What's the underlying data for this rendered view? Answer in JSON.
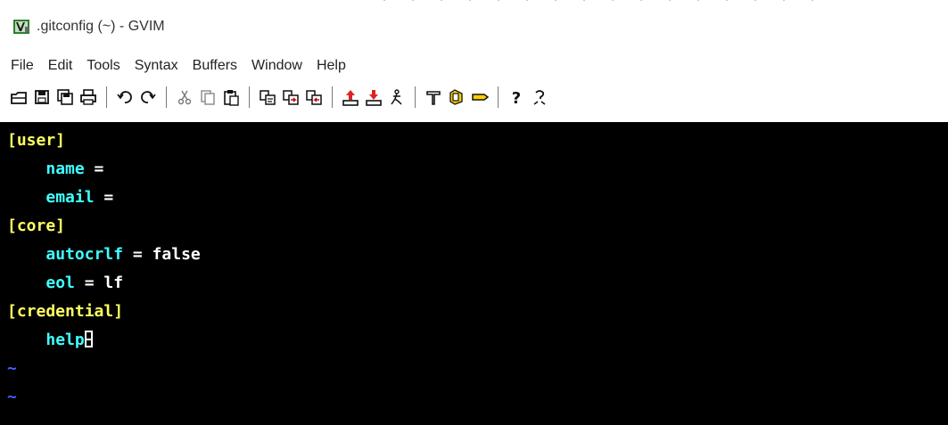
{
  "window": {
    "title": ".gitconfig (~) - GVIM",
    "app_icon": "gvim-icon"
  },
  "menubar": {
    "items": [
      "File",
      "Edit",
      "Tools",
      "Syntax",
      "Buffers",
      "Window",
      "Help"
    ]
  },
  "toolbar": {
    "groups": [
      [
        "open-icon",
        "save-icon",
        "save-all-icon",
        "print-icon"
      ],
      [
        "undo-icon",
        "redo-icon"
      ],
      [
        "cut-icon",
        "copy-icon",
        "paste-icon"
      ],
      [
        "replace-icon",
        "find-next-icon",
        "find-prev-icon"
      ],
      [
        "load-session-icon",
        "save-session-icon",
        "run-script-icon"
      ],
      [
        "make-icon",
        "build-tags-icon",
        "jump-to-tag-icon"
      ],
      [
        "help-icon",
        "find-help-icon"
      ]
    ]
  },
  "editor": {
    "lines": [
      {
        "type": "section",
        "text": "[user]"
      },
      {
        "type": "kv",
        "key": "name",
        "op": " =",
        "value": ""
      },
      {
        "type": "kv",
        "key": "email",
        "op": " =",
        "value": ""
      },
      {
        "type": "section",
        "text": "[core]"
      },
      {
        "type": "kv",
        "key": "autocrlf",
        "op": " = ",
        "value": "false"
      },
      {
        "type": "kv",
        "key": "eol",
        "op": " = ",
        "value": "lf"
      },
      {
        "type": "section",
        "text": "[credential]"
      },
      {
        "type": "cursorline",
        "key": "help"
      },
      {
        "type": "tilde",
        "text": "~"
      },
      {
        "type": "tilde",
        "text": "~"
      }
    ],
    "colors": {
      "background": "#000000",
      "section": "#ffff60",
      "key": "#40ffff",
      "value": "#ffffff",
      "tilde": "#4060ff"
    }
  }
}
